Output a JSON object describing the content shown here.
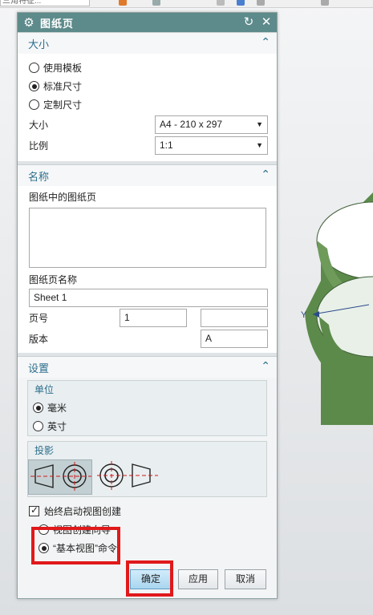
{
  "toolbar": {
    "combo_text": "三角特征..."
  },
  "dialog": {
    "title": "图纸页",
    "size_section": {
      "header": "大小",
      "radios": [
        {
          "label": "使用模板",
          "selected": false
        },
        {
          "label": "标准尺寸",
          "selected": true
        },
        {
          "label": "定制尺寸",
          "selected": false
        }
      ],
      "size_label": "大小",
      "size_value": "A4 - 210 x 297",
      "scale_label": "比例",
      "scale_value": "1:1"
    },
    "name_section": {
      "header": "名称",
      "list_label": "图纸中的图纸页",
      "sheet_name_label": "图纸页名称",
      "sheet_name_value": "Sheet 1",
      "page_label": "页号",
      "page_value": "1",
      "page_extra_value": "",
      "version_label": "版本",
      "version_value": "A"
    },
    "settings_section": {
      "header": "设置",
      "unit_group": {
        "title": "单位",
        "radios": [
          {
            "label": "毫米",
            "selected": true
          },
          {
            "label": "英寸",
            "selected": false
          }
        ]
      },
      "projection_group": {
        "title": "投影"
      },
      "auto_view_label": "始终启动视图创建",
      "auto_view_checked": true,
      "view_radios": [
        {
          "label": "视图创建向导",
          "selected": false
        },
        {
          "label": "“基本视图”命令",
          "selected": true
        }
      ]
    },
    "buttons": {
      "ok": "确定",
      "apply": "应用",
      "cancel": "取消"
    }
  },
  "model": {
    "axis_label": "Y"
  },
  "colors": {
    "title_bar": "#5d8a8b",
    "section_header": "#2d6f8c",
    "highlight": "#e0191b",
    "model": "#5c8a4a"
  }
}
